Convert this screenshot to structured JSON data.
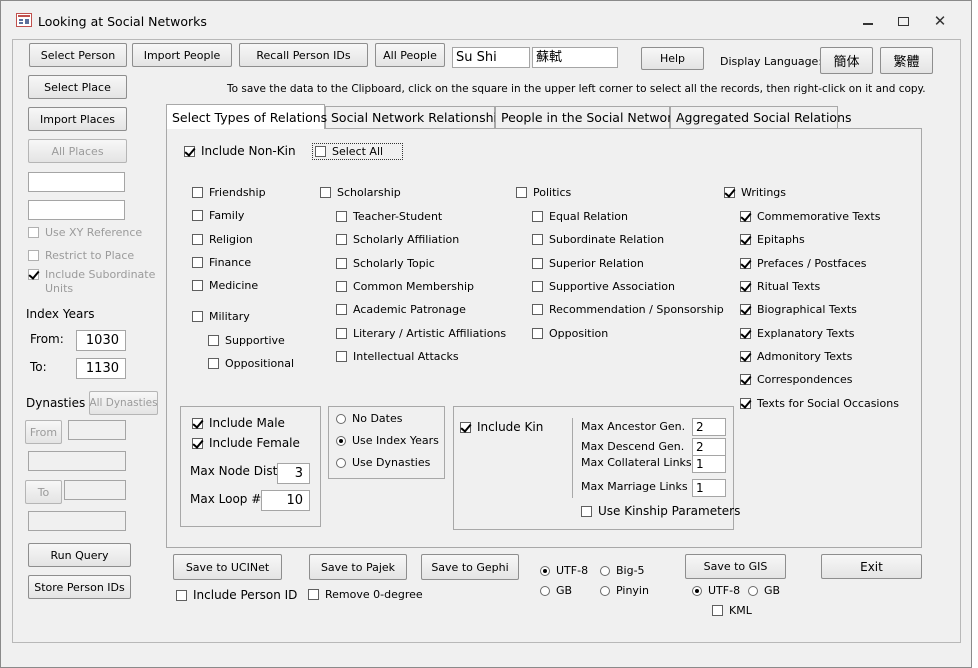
{
  "window": {
    "title": "Looking at Social Networks"
  },
  "toolbar": {
    "select_person": "Select Person",
    "import_people": "Import People",
    "recall_ids": "Recall Person IDs",
    "all_people": "All People",
    "name_en": "Su Shi",
    "name_zh": "蘇軾",
    "help": "Help",
    "display_language": "Display Language:",
    "lang_simplified": "簡体",
    "lang_traditional": "繁體"
  },
  "instruction": "To save the data to the Clipboard, click on the square in the upper left corner to select all the records, then right-click on it and copy.",
  "left": {
    "select_place": "Select Place",
    "import_places": "Import Places",
    "all_places": "All Places",
    "place_field1": "",
    "place_field2": "",
    "use_xy": "Use XY Reference",
    "restrict": "Restrict to Place",
    "include_sub": "Include Subordinate",
    "include_sub2": "Units",
    "index_years": "Index Years",
    "from_label": "From:",
    "from_value": "1030",
    "to_label": "To:",
    "to_value": "1130",
    "dynasties": "Dynasties",
    "all_dynasties": "All Dynasties",
    "from_btn": "From",
    "to_btn": "To",
    "run_query": "Run Query",
    "store_ids": "Store Person IDs"
  },
  "tabs": [
    "Select Types of Relations",
    "Social Network Relationship",
    "People in the Social Network",
    "Aggregated Social Relations"
  ],
  "relations": {
    "include_nonkin": "Include Non-Kin",
    "select_all": "Select All",
    "col1": [
      "Friendship",
      "Family",
      "Religion",
      "Finance",
      "Medicine",
      "Military"
    ],
    "col1_sub": [
      "Supportive",
      "Oppositional"
    ],
    "scholarship": "Scholarship",
    "scholarship_items": [
      "Teacher-Student",
      "Scholarly Affiliation",
      "Scholarly Topic",
      "Common Membership",
      "Academic Patronage",
      "Literary / Artistic Affiliations",
      "Intellectual Attacks"
    ],
    "politics": "Politics",
    "politics_items": [
      "Equal Relation",
      "Subordinate Relation",
      "Superior Relation",
      "Supportive Association",
      "Recommendation / Sponsorship",
      "Opposition"
    ],
    "writings": "Writings",
    "writings_items": [
      "Commemorative Texts",
      "Epitaphs",
      "Prefaces / Postfaces",
      "Ritual Texts",
      "Biographical Texts",
      "Explanatory Texts",
      "Admonitory Texts",
      "Correspondences",
      "Texts for Social Occasions"
    ]
  },
  "options": {
    "include_male": "Include Male",
    "include_female": "Include Female",
    "max_node": "Max Node Dist.",
    "max_node_val": "3",
    "max_loop": "Max Loop #",
    "max_loop_val": "10",
    "no_dates": "No Dates",
    "use_index_years": "Use Index Years",
    "use_dynasties": "Use Dynasties"
  },
  "kin": {
    "include_kin": "Include Kin",
    "max_ancestor": "Max Ancestor Gen.",
    "max_ancestor_val": "2",
    "max_descend": "Max Descend Gen.",
    "max_descend_val": "2",
    "max_collateral": "Max Collateral Links",
    "max_collateral_val": "1",
    "max_marriage": "Max Marriage Links",
    "max_marriage_val": "1",
    "use_kinship": "Use Kinship Parameters"
  },
  "bottom": {
    "save_ucinet": "Save to UCINet",
    "save_pajek": "Save to Pajek",
    "save_gephi": "Save to Gephi",
    "include_pid": "Include Person ID",
    "remove_zero": "Remove 0-degree",
    "utf8": "UTF-8",
    "big5": "Big-5",
    "gb": "GB",
    "pinyin": "Pinyin",
    "save_gis": "Save to GIS",
    "gis_utf8": "UTF-8",
    "gis_gb": "GB",
    "kml": "KML",
    "exit": "Exit"
  }
}
